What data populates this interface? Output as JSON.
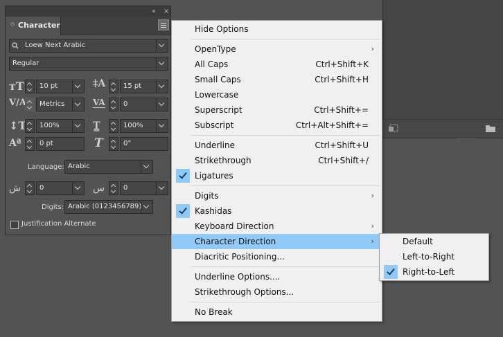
{
  "panel": {
    "tab_title": "Character",
    "font_family": "Loew Next Arabic",
    "font_style": "Regular",
    "font_size": "10 pt",
    "leading": "15 pt",
    "kerning": "Metrics",
    "tracking": "0",
    "vertical_scale": "100%",
    "horizontal_scale": "100%",
    "baseline_shift": "0 pt",
    "skew": "0°",
    "language_label": "Language:",
    "language": "Arabic",
    "arabic_param_1": "0",
    "arabic_param_2": "0",
    "digits_label": "Digits:",
    "digits": "Arabic (0123456789)",
    "justification_alternate": "Justification Alternate",
    "collapse_glyph": "«",
    "close_glyph": "×"
  },
  "menu": {
    "items": [
      {
        "label": "Hide Options",
        "shortcut": ""
      },
      {
        "label": "OpenType",
        "shortcut": ""
      },
      {
        "label": "All Caps",
        "shortcut": "Ctrl+Shift+K"
      },
      {
        "label": "Small Caps",
        "shortcut": "Ctrl+Shift+H"
      },
      {
        "label": "Lowercase",
        "shortcut": ""
      },
      {
        "label": "Superscript",
        "shortcut": "Ctrl+Shift+="
      },
      {
        "label": "Subscript",
        "shortcut": "Ctrl+Alt+Shift+="
      },
      {
        "label": "Underline",
        "shortcut": "Ctrl+Shift+U"
      },
      {
        "label": "Strikethrough",
        "shortcut": "Ctrl+Shift+/"
      },
      {
        "label": "Ligatures",
        "shortcut": "",
        "checked": true
      },
      {
        "label": "Digits",
        "shortcut": ""
      },
      {
        "label": "Kashidas",
        "shortcut": "",
        "checked": true
      },
      {
        "label": "Keyboard Direction",
        "shortcut": ""
      },
      {
        "label": "Character Direction",
        "shortcut": "",
        "highlighted": true
      },
      {
        "label": "Diacritic Positioning...",
        "shortcut": ""
      },
      {
        "label": "Underline Options....",
        "shortcut": ""
      },
      {
        "label": "Strikethrough Options...",
        "shortcut": ""
      },
      {
        "label": "No Break",
        "shortcut": ""
      }
    ],
    "submenu_arrow": "›"
  },
  "submenu": {
    "items": [
      {
        "label": "Default",
        "checked": false
      },
      {
        "label": "Left-to-Right",
        "checked": false
      },
      {
        "label": "Right-to-Left",
        "checked": true
      }
    ]
  },
  "colors": {
    "highlight": "#91c9f7",
    "menu_bg": "#f0f0f0",
    "panel_bg": "#535353"
  }
}
